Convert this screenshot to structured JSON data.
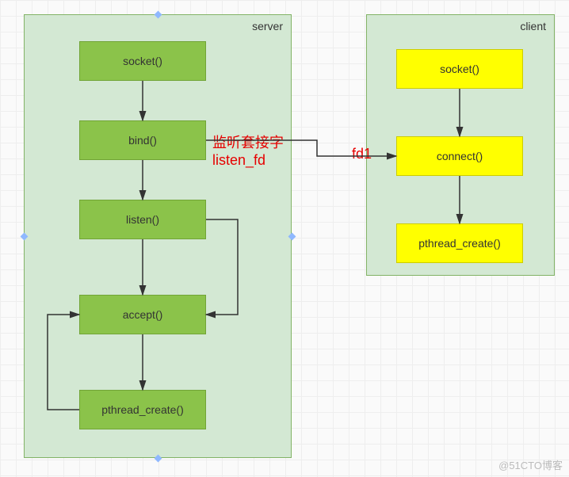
{
  "server": {
    "title": "server",
    "nodes": {
      "socket": "socket()",
      "bind": "bind()",
      "listen": "listen()",
      "accept": "accept()",
      "pthread_create": "pthread_create()"
    }
  },
  "client": {
    "title": "client",
    "nodes": {
      "socket": "socket()",
      "connect": "connect()",
      "pthread_create": "pthread_create()"
    }
  },
  "labels": {
    "listen_fd_line1": "监听套接字",
    "listen_fd_line2": "listen_fd",
    "fd1": "fd1"
  },
  "watermark": "@51CTO博客",
  "chart_data": {
    "type": "flowchart",
    "groups": [
      {
        "id": "server",
        "label": "server",
        "nodes": [
          "socket()",
          "bind()",
          "listen()",
          "accept()",
          "pthread_create()"
        ]
      },
      {
        "id": "client",
        "label": "client",
        "nodes": [
          "socket()",
          "connect()",
          "pthread_create()"
        ]
      }
    ],
    "edges": [
      {
        "from": "server.socket()",
        "to": "server.bind()"
      },
      {
        "from": "server.bind()",
        "to": "server.listen()"
      },
      {
        "from": "server.listen()",
        "to": "server.accept()"
      },
      {
        "from": "server.accept()",
        "to": "server.pthread_create()"
      },
      {
        "from": "server.pthread_create()",
        "to": "server.accept()",
        "kind": "loop"
      },
      {
        "from": "server.listen()",
        "to": "server.accept()",
        "kind": "side-loop"
      },
      {
        "from": "server.bind()",
        "to": "client.connect()",
        "label": "监听套接字 listen_fd / fd1"
      },
      {
        "from": "client.socket()",
        "to": "client.connect()"
      },
      {
        "from": "client.connect()",
        "to": "client.pthread_create()"
      }
    ]
  }
}
